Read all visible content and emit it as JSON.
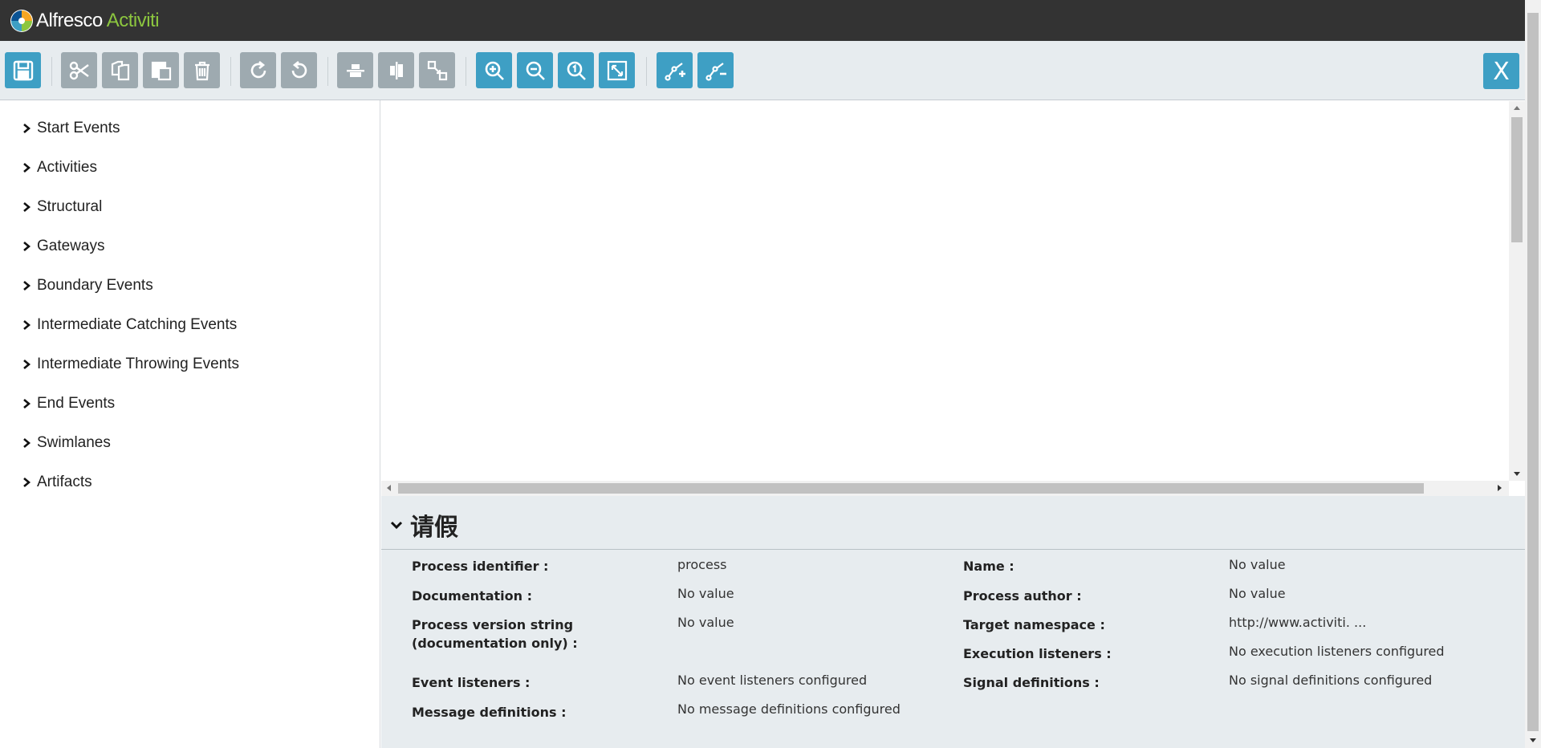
{
  "header": {
    "brand": "Alfresco",
    "product": "Activiti"
  },
  "toolbar": {
    "buttons": [
      {
        "name": "save-icon",
        "color": "blue"
      },
      {
        "name": "cut-icon",
        "color": "gray"
      },
      {
        "name": "copy-icon",
        "color": "gray"
      },
      {
        "name": "paste-icon",
        "color": "gray"
      },
      {
        "name": "delete-icon",
        "color": "gray"
      },
      {
        "name": "redo-icon",
        "color": "gray"
      },
      {
        "name": "undo-icon",
        "color": "gray"
      },
      {
        "name": "align-vertical-icon",
        "color": "gray"
      },
      {
        "name": "align-horizontal-icon",
        "color": "gray"
      },
      {
        "name": "same-size-icon",
        "color": "gray"
      },
      {
        "name": "zoom-in-icon",
        "color": "blue"
      },
      {
        "name": "zoom-out-icon",
        "color": "blue"
      },
      {
        "name": "zoom-actual-icon",
        "color": "blue"
      },
      {
        "name": "zoom-fit-icon",
        "color": "blue"
      },
      {
        "name": "add-bendpoint-icon",
        "color": "blue"
      },
      {
        "name": "remove-bendpoint-icon",
        "color": "blue"
      }
    ],
    "close_label": "X"
  },
  "palette": {
    "items": [
      "Start Events",
      "Activities",
      "Structural",
      "Gateways",
      "Boundary Events",
      "Intermediate Catching Events",
      "Intermediate Throwing Events",
      "End Events",
      "Swimlanes",
      "Artifacts"
    ]
  },
  "properties": {
    "title": "请假",
    "left": [
      {
        "label": "Process identifier :",
        "value": "process"
      },
      {
        "label": "Documentation :",
        "value": "No value"
      },
      {
        "label": "Process version string (documentation only) :",
        "value": "No value"
      },
      {
        "label": "Event listeners :",
        "value": "No event listeners configured"
      },
      {
        "label": "Message definitions :",
        "value": "No message definitions configured"
      }
    ],
    "right": [
      {
        "label": "Name :",
        "value": "No value"
      },
      {
        "label": "Process author :",
        "value": "No value"
      },
      {
        "label": "Target namespace :",
        "value": "http://www.activiti. ..."
      },
      {
        "label": "Execution listeners :",
        "value": "No execution listeners configured"
      },
      {
        "label": "Signal definitions :",
        "value": "No signal definitions configured"
      }
    ]
  },
  "colors": {
    "header_bg": "#333333",
    "accent_blue": "#3e9fc4",
    "disabled_gray": "#9eaab0",
    "panel_bg": "#e7ecef",
    "logo_green": "#8cc63f"
  }
}
